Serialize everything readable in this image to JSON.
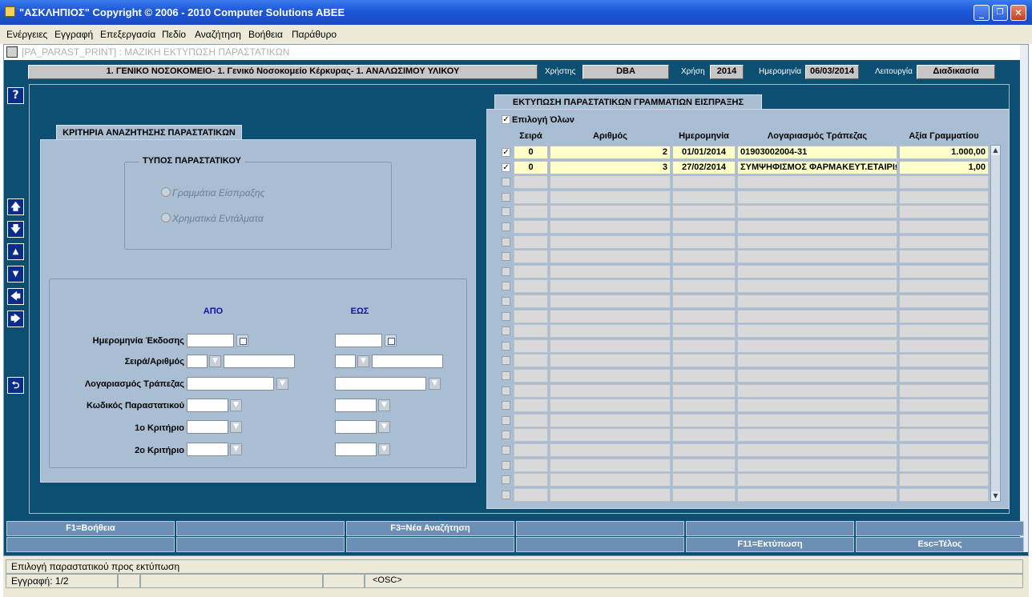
{
  "window": {
    "title": "\"ΑΣΚΛΗΠΙΟΣ\" Copyright © 2006 - 2010 Computer Solutions ABEE",
    "min_glyph": "_",
    "max_glyph": "❐",
    "close_glyph": "✕"
  },
  "menu": [
    "Ενέργειες",
    "Εγγραφή",
    "Επεξεργασία",
    "Πεδίο",
    "Αναζήτηση",
    "Βοήθεια",
    "Παράθυρο"
  ],
  "form_title": "[PA_PARAST_PRINT]  :  ΜΑΖΙΚΗ ΕΚΤΥΠΩΣΗ ΠΑΡΑΣΤΑΤΙΚΩΝ",
  "info": {
    "organization": "1. ΓΕΝΙΚΟ ΝΟΣΟΚΟΜΕΙΟ- 1. Γενικό Νοσοκομείο Κέρκυρας- 1. ΑΝΑΛΩΣΙΜΟΥ ΥΛΙΚΟΥ",
    "user_label": "Χρήστης",
    "user": "DBA",
    "year_label": "Χρήση",
    "year": "2014",
    "date_label": "Ημερομηνία",
    "date": "06/03/2014",
    "function_label": "Λειτουργία",
    "function": "Διαδικασία"
  },
  "nav_buttons": {
    "help": "?",
    "up": "🡅",
    "down": "🡇",
    "prev": "▲",
    "next": "▼",
    "left": "🡄",
    "right": "🡆",
    "back": "⮌"
  },
  "search": {
    "tab_title": "ΚΡΙΤΗΡΙΑ ΑΝΑΖΗΤΗΣΗΣ ΠΑΡΑΣΤΑΤΙΚΩΝ",
    "type_group_title": "ΤΥΠΟΣ ΠΑΡΑΣΤΑΤΙΚΟΥ",
    "type_options": [
      "Γραμμάτια Είσπραξης",
      "Χρηματικά Εντάλματα"
    ],
    "from_header": "ΑΠΟ",
    "to_header": "ΕΩΣ",
    "fields": {
      "issue_date": "Ημερομηνία Έκδοσης",
      "series_number": "Σειρά/Αριθμός",
      "bank_account": "Λογαριασμός Τράπεζας",
      "document_code": "Κωδικός Παραστατικού",
      "criterion1": "1ο Κριτήριο",
      "criterion2": "2ο Κριτήριο"
    },
    "dropdown_glyph": "▼"
  },
  "print": {
    "tab_title": "ΕΚΤΥΠΩΣΗ ΠΑΡΑΣΤΑΤΙΚΩΝ ΓΡΑΜΜΑΤΙΩΝ ΕΙΣΠΡΑΞΗΣ",
    "select_all": "Επιλογή Όλων",
    "check_glyph": "✓",
    "scroll_up": "▲",
    "scroll_down": "▼",
    "columns": [
      "Σειρά",
      "Αριθμός",
      "Ημερομηνία",
      "Λογαριασμός Τράπεζας",
      "Αξία Γραμματίου"
    ],
    "rows": [
      {
        "series": "0",
        "number": "2",
        "date": "01/01/2014",
        "account": "01903002004-31",
        "amount": "1.000,00"
      },
      {
        "series": "0",
        "number": "3",
        "date": "27/02/2014",
        "account": "ΣΥΜΨΗΦΙΣΜΟΣ ΦΑΡΜΑΚΕΥΤ.ΕΤΑΙΡΙΩΝ",
        "amount": "1,00"
      }
    ]
  },
  "function_keys": {
    "row1": [
      "F1=Βοήθεια",
      "",
      "F3=Νέα Αναζήτηση",
      "",
      "",
      ""
    ],
    "row2": [
      "",
      "",
      "",
      "",
      "F11=Εκτύπωση",
      "Esc=Τέλος"
    ]
  },
  "status": {
    "message": "Επιλογή παραστατικού προς εκτύπωση",
    "record": "Εγγραφή: 1/2",
    "mode": "<OSC>"
  }
}
